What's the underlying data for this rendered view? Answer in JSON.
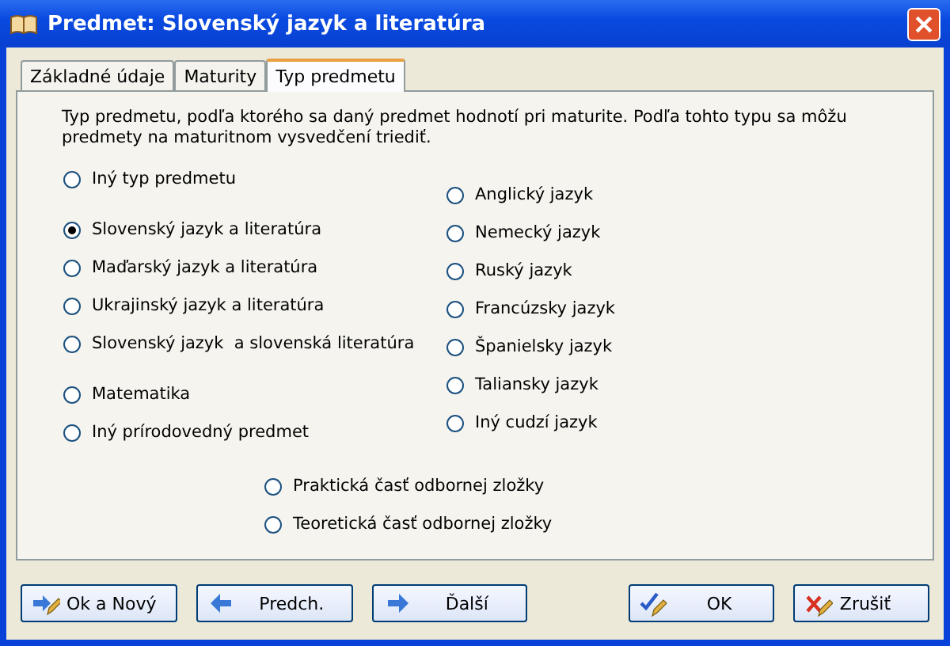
{
  "window": {
    "title": "Predmet: Slovenský jazyk a literatúra"
  },
  "tabs": [
    {
      "label": "Základné údaje",
      "selected": false
    },
    {
      "label": "Maturity",
      "selected": false
    },
    {
      "label": "Typ predmetu",
      "selected": true
    }
  ],
  "description": "Typ predmetu, podľa ktorého sa daný predmet hodnotí pri maturite. Podľa tohto typu sa môžu predmety na maturitnom vysvedčení triediť.",
  "left_options": [
    {
      "label": "Iný typ predmetu",
      "selected": false
    },
    {
      "label": "Slovenský jazyk a literatúra",
      "selected": true
    },
    {
      "label": "Maďarský jazyk a literatúra",
      "selected": false
    },
    {
      "label": "Ukrajinský jazyk a literatúra",
      "selected": false
    },
    {
      "label": "Slovenský jazyk  a slovenská literatúra",
      "selected": false
    },
    {
      "label": "Matematika",
      "selected": false
    },
    {
      "label": "Iný prírodovedný predmet",
      "selected": false
    }
  ],
  "right_options": [
    {
      "label": "Anglický jazyk",
      "selected": false
    },
    {
      "label": "Nemecký jazyk",
      "selected": false
    },
    {
      "label": "Ruský jazyk",
      "selected": false
    },
    {
      "label": "Francúzsky jazyk",
      "selected": false
    },
    {
      "label": "Španielsky jazyk",
      "selected": false
    },
    {
      "label": "Taliansky jazyk",
      "selected": false
    },
    {
      "label": "Iný cudzí jazyk",
      "selected": false
    }
  ],
  "bottom_options": [
    {
      "label": "Praktická časť odbornej zložky",
      "selected": false
    },
    {
      "label": "Teoretická časť odbornej zložky",
      "selected": false
    }
  ],
  "buttons": [
    {
      "label": "Ok a Nový",
      "kind": "save-new"
    },
    {
      "label": "Predch.",
      "kind": "prev"
    },
    {
      "label": "Ďalší",
      "kind": "next"
    },
    {
      "label": "OK",
      "kind": "ok"
    },
    {
      "label": "Zrušiť",
      "kind": "cancel"
    }
  ]
}
